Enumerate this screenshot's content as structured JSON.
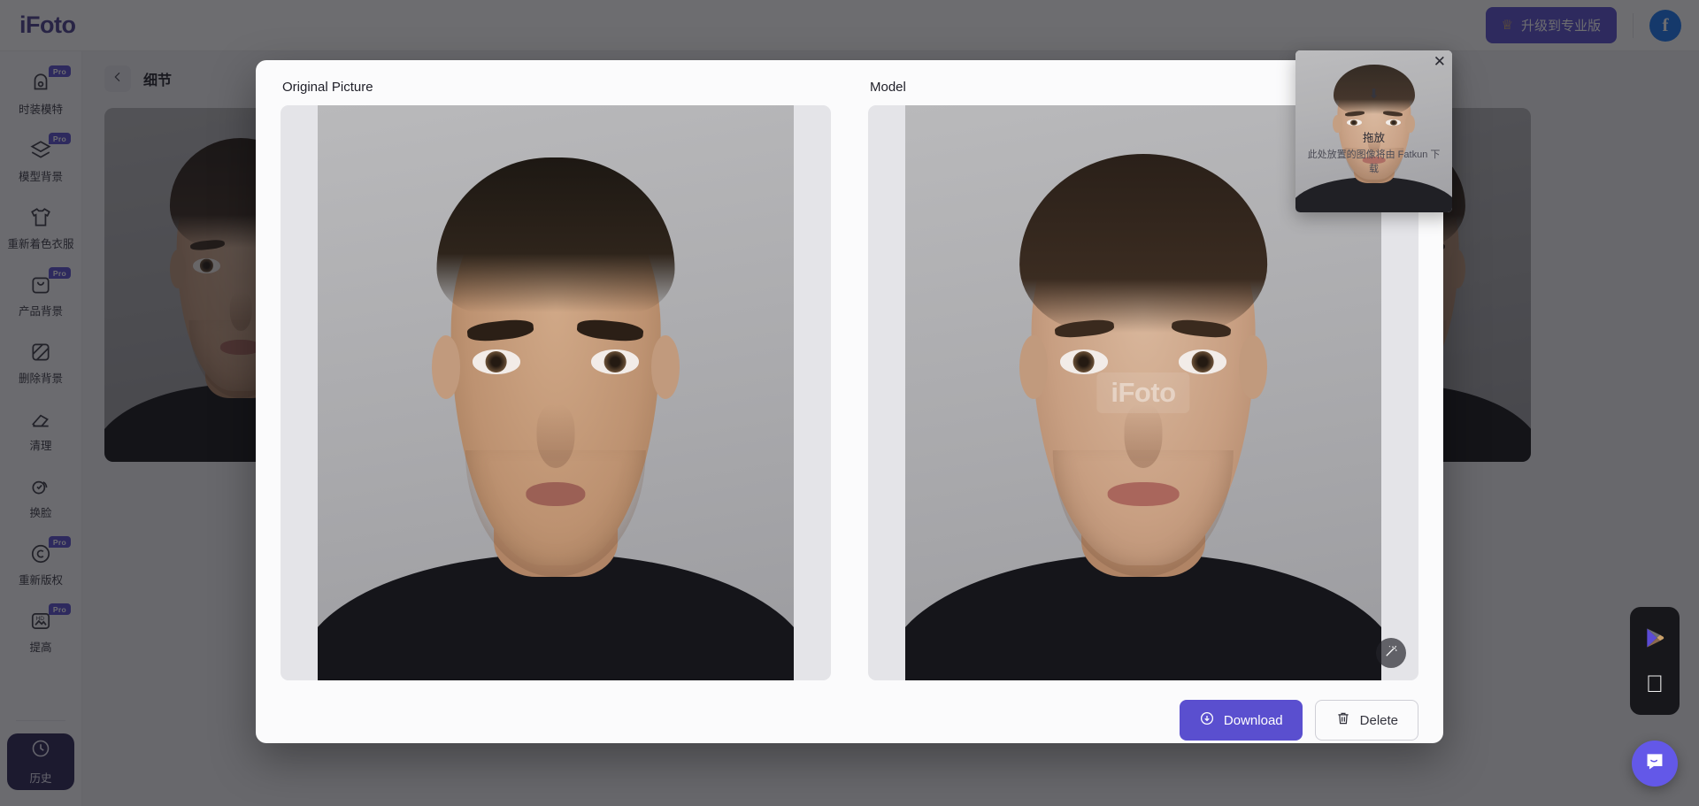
{
  "topbar": {
    "logo": "iFoto",
    "upgrade_label": "升级到专业版",
    "crown_icon": "crown-icon",
    "avatar_letter": "f"
  },
  "sidebar": {
    "items": [
      {
        "label": "时装模特",
        "icon": "mannequin-icon",
        "pro": "Pro"
      },
      {
        "label": "模型背景",
        "icon": "layers-icon",
        "pro": "Pro"
      },
      {
        "label": "重新着色衣服",
        "icon": "tshirt-icon",
        "pro": ""
      },
      {
        "label": "产品背景",
        "icon": "bag-icon",
        "pro": "Pro"
      },
      {
        "label": "删除背景",
        "icon": "transparency-icon",
        "pro": ""
      },
      {
        "label": "清理",
        "icon": "eraser-icon",
        "pro": ""
      },
      {
        "label": "换脸",
        "icon": "faceswap-icon",
        "pro": ""
      },
      {
        "label": "重新版权",
        "icon": "copyright-icon",
        "pro": "Pro"
      },
      {
        "label": "提高",
        "icon": "hd-image-icon",
        "pro": "Pro"
      }
    ],
    "history_label": "历史",
    "history_icon": "clock-icon"
  },
  "breadcrumb": {
    "back_icon": "arrow-left-icon",
    "title": "细节"
  },
  "modal": {
    "original_label": "Original Picture",
    "model_label": "Model",
    "watermark": "iFoto",
    "wand_icon": "magic-wand-icon",
    "download_label": "Download",
    "download_icon": "cloud-download-icon",
    "delete_label": "Delete",
    "delete_icon": "trash-icon"
  },
  "fatkun": {
    "close_icon": "close-icon",
    "arrow_icon": "arrow-down-icon",
    "title": "拖放",
    "subtitle": "此处放置的图像将由 Fatkun 下载"
  },
  "floating": {
    "google_play_icon": "google-play-icon",
    "apple_icon": "apple-icon",
    "chat_icon": "chat-bubble-icon"
  },
  "colors": {
    "accent": "#5a4fcf",
    "accent_dark": "#2b2555",
    "chat": "#6358e8",
    "logo": "#4a3f8f"
  }
}
